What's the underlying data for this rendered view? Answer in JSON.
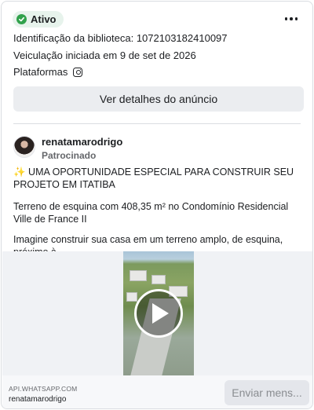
{
  "status": {
    "label": "Ativo",
    "color": "#31a24c",
    "icon": "check-icon"
  },
  "menu": {
    "icon": "more-icon"
  },
  "library_id": "Identificação da biblioteca: 1072103182410097",
  "start_date": "Veiculação iniciada em 9 de set de 2026",
  "platforms": {
    "label": "Plataformas",
    "icons": [
      "instagram-icon"
    ]
  },
  "details_button": "Ver detalhes do anúncio",
  "ad": {
    "page_name": "renatamarodrigo",
    "sponsored": "Patrocinado",
    "paragraphs": [
      "✨ UMA OPORTUNIDADE ESPECIAL PARA CONSTRUIR SEU PROJETO EM ITATIBA",
      "Terreno de esquina com 408,35 m² no Condomínio Residencial Ville de France II",
      "Imagine construir sua casa em um terreno amplo, de esquina, próximo à ..."
    ],
    "media": {
      "type": "video",
      "icon": "play-icon"
    }
  },
  "footer": {
    "domain": "API.WHATSAPP.COM",
    "name": "renatamarodrigo",
    "cta_button": "Enviar mens..."
  }
}
